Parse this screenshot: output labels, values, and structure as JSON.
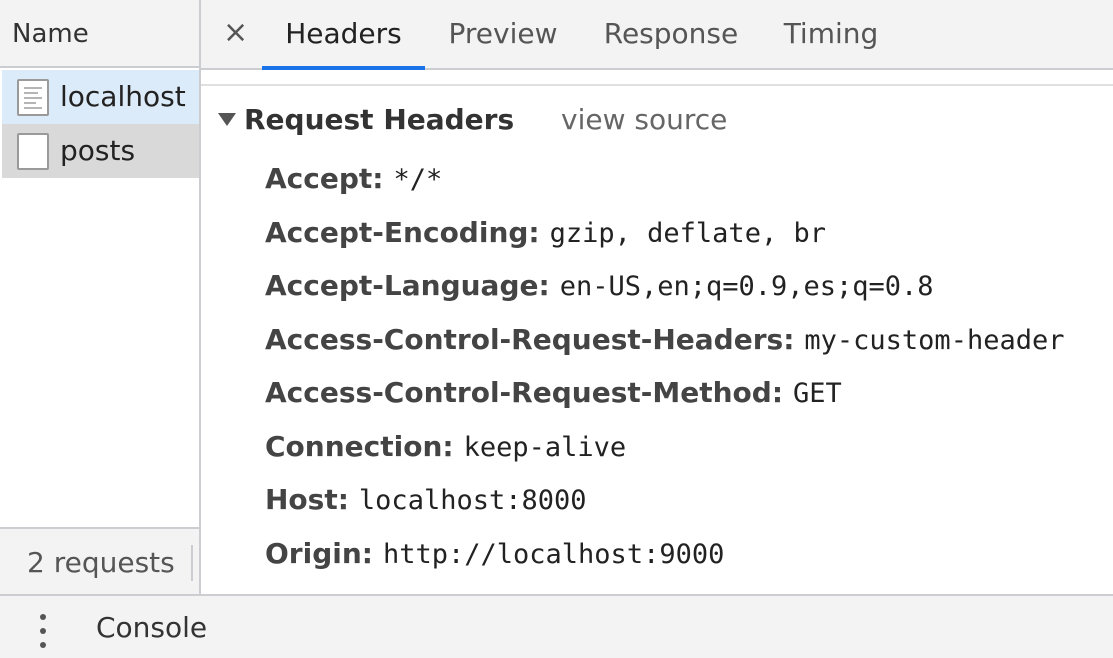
{
  "requests_panel": {
    "header": "Name",
    "items": [
      {
        "label": "localhost",
        "icon": "document-icon"
      },
      {
        "label": "posts",
        "icon": "file-icon"
      }
    ],
    "footer": "2 requests"
  },
  "detail": {
    "close": "×",
    "tabs": [
      {
        "label": "Headers"
      },
      {
        "label": "Preview"
      },
      {
        "label": "Response"
      },
      {
        "label": "Timing"
      }
    ],
    "active_tab": "Headers",
    "section": {
      "title": "Request Headers",
      "view_source": "view source"
    },
    "headers": [
      {
        "key": "Accept:",
        "value": "*/*"
      },
      {
        "key": "Accept-Encoding:",
        "value": "gzip, deflate, br"
      },
      {
        "key": "Accept-Language:",
        "value": "en-US,en;q=0.9,es;q=0.8"
      },
      {
        "key": "Access-Control-Request-Headers:",
        "value": "my-custom-header"
      },
      {
        "key": "Access-Control-Request-Method:",
        "value": "GET"
      },
      {
        "key": "Connection:",
        "value": "keep-alive"
      },
      {
        "key": "Host:",
        "value": "localhost:8000"
      },
      {
        "key": "Origin:",
        "value": "http://localhost:9000"
      }
    ]
  },
  "drawer": {
    "menu_icon": "more-vertical-icon",
    "tab": "Console"
  },
  "colors": {
    "accent": "#1a73e8",
    "selected_row": "#dcebfa",
    "hover_row": "#d9d9d9"
  }
}
